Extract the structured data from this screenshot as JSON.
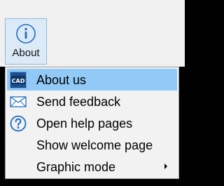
{
  "ribbon": {
    "about_button": {
      "label": "About",
      "icon": "info-icon"
    }
  },
  "menu": {
    "items": [
      {
        "label": "About us",
        "icon": "cad-logo-icon",
        "highlighted": true
      },
      {
        "label": "Send feedback",
        "icon": "envelope-icon",
        "highlighted": false
      },
      {
        "label": "Open help pages",
        "icon": "question-icon",
        "highlighted": false
      },
      {
        "label": "Show welcome page",
        "icon": "",
        "highlighted": false
      },
      {
        "label": "Graphic mode",
        "icon": "",
        "has_submenu": true,
        "highlighted": false
      }
    ]
  },
  "colors": {
    "highlight": "#91c9f7",
    "button_hover_bg": "#dceaf7",
    "button_border": "#8fb9df",
    "icon_blue": "#1e6fc0",
    "menu_bg": "#f2f2f2"
  },
  "logo_text": "CAD"
}
